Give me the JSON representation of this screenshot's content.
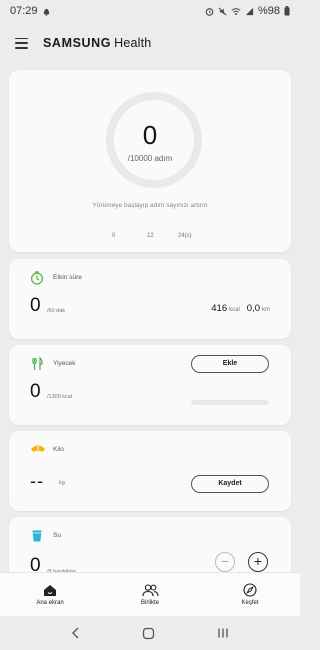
{
  "status_bar": {
    "time": "07:29",
    "battery": "%98"
  },
  "app_bar": {
    "brand_bold": "SAMSUNG",
    "brand_light": "Health"
  },
  "steps": {
    "count": "0",
    "goal": "/10000 adım",
    "message": "Yürümeye başlayıp adım sayınızı artırın",
    "timeline": [
      "0",
      "12",
      "24(s)"
    ]
  },
  "active_time": {
    "title": "Etkin süre",
    "value": "0",
    "unit": "/60 dak",
    "kcal_value": "416",
    "kcal_unit": "kcal",
    "km_value": "0,0",
    "km_unit": "km"
  },
  "food": {
    "title": "Yiyecek",
    "value": "0",
    "unit": "/1309 kcal",
    "button": "Ekle"
  },
  "weight": {
    "title": "Kilo",
    "value": "--",
    "unit": "kg",
    "button": "Kaydet"
  },
  "water": {
    "title": "Su",
    "value": "0",
    "unit": "/8 bardaklar"
  },
  "bottom_nav": {
    "items": [
      {
        "label": "Ana ekran",
        "icon": "home-icon"
      },
      {
        "label": "Birlikte",
        "icon": "people-icon"
      },
      {
        "label": "Keşfet",
        "icon": "compass-icon"
      }
    ]
  }
}
